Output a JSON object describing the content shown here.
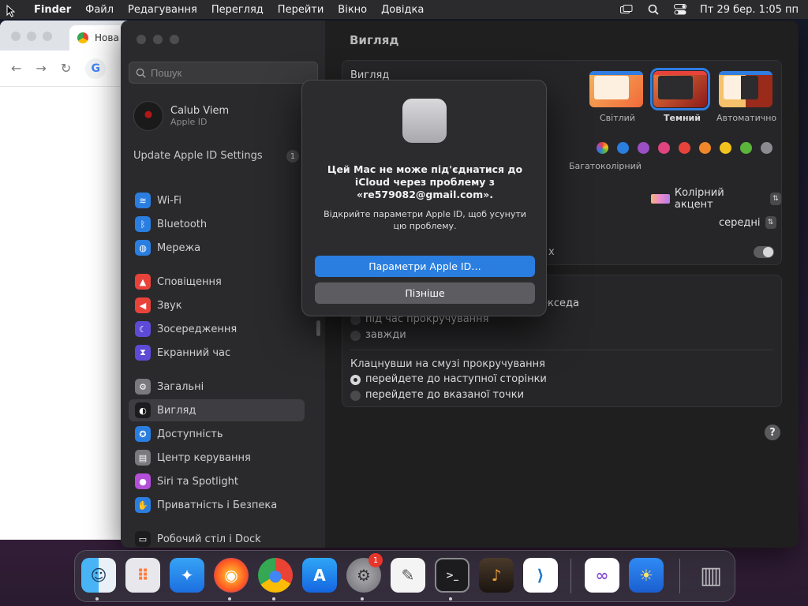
{
  "menubar": {
    "items": [
      "Finder",
      "Файл",
      "Редагування",
      "Перегляд",
      "Перейти",
      "Вікно",
      "Довідка"
    ],
    "clock": "Пт 29 бер.  1:05 пп"
  },
  "chrome": {
    "tab_title": "Нова"
  },
  "sidebar": {
    "search_placeholder": "Пошук",
    "account_name": "Calub Viem",
    "account_sub": "Apple ID",
    "update_label": "Update Apple ID Settings",
    "update_badge": "1",
    "items": [
      {
        "label": "Wi-Fi",
        "icon": "wifi-icon",
        "color": "#2a7ee0"
      },
      {
        "label": "Bluetooth",
        "icon": "bluetooth-icon",
        "color": "#2a7ee0"
      },
      {
        "label": "Мережа",
        "icon": "globe-icon",
        "color": "#2a7ee0"
      },
      {
        "label": "Сповіщення",
        "icon": "bell-icon",
        "color": "#e8433b"
      },
      {
        "label": "Звук",
        "icon": "speaker-icon",
        "color": "#e8433b"
      },
      {
        "label": "Зосередження",
        "icon": "moon-icon",
        "color": "#5e4ad6"
      },
      {
        "label": "Екранний час",
        "icon": "hourglass-icon",
        "color": "#5e4ad6"
      },
      {
        "label": "Загальні",
        "icon": "gear-icon",
        "color": "#7a7a7e"
      },
      {
        "label": "Вигляд",
        "icon": "appearance-icon",
        "color": "#1c1c1e"
      },
      {
        "label": "Доступність",
        "icon": "accessibility-icon",
        "color": "#2a7ee0"
      },
      {
        "label": "Центр керування",
        "icon": "control-center-icon",
        "color": "#7a7a7e"
      },
      {
        "label": "Siri та Spotlight",
        "icon": "siri-icon",
        "color": "#b34fd8"
      },
      {
        "label": "Приватність і Безпека",
        "icon": "hand-icon",
        "color": "#2a7ee0"
      },
      {
        "label": "Робочий стіл і Dock",
        "icon": "dock-icon",
        "color": "#1c1c1e"
      }
    ]
  },
  "content": {
    "title": "Вигляд",
    "appearance_label": "Вигляд",
    "themes": [
      "Світлий",
      "Темний",
      "Автоматично"
    ],
    "accent_multicolor_label": "Багатоколірний",
    "accent_colors": [
      "#2a7ee0",
      "#9a4fc4",
      "#e0447f",
      "#e8433b",
      "#f0882a",
      "#f2c31f",
      "#5cb53b",
      "#8c8c90"
    ],
    "highlight_value": "Колірний акцент",
    "sidebar_size_value": "середні",
    "partial_text_1": "х",
    "partial_text_2": "екседа",
    "scroll_show_options": [
      "під час прокручування",
      "завжди"
    ],
    "click_label": "Клацнувши на смузі прокручування",
    "click_options": [
      "перейдете до наступної сторінки",
      "перейдете до вказаної точки"
    ]
  },
  "modal": {
    "title": "Цей Mac не може під'єднатися до iCloud через проблему з «re579082@gmail.com».",
    "text": "Відкрийте параметри Apple ID, щоб усунути цю проблему.",
    "primary_button": "Параметри Apple ID…",
    "secondary_button": "Пізніше"
  },
  "dock": {
    "apps": [
      "Finder",
      "Launchpad",
      "Safari",
      "Firefox",
      "Chrome",
      "App Store",
      "System Settings",
      "TextEdit",
      "Terminal",
      "GarageBand",
      "Visual Studio Code",
      "Visual Studio",
      "Weather",
      "Trash"
    ],
    "settings_badge": "1"
  }
}
